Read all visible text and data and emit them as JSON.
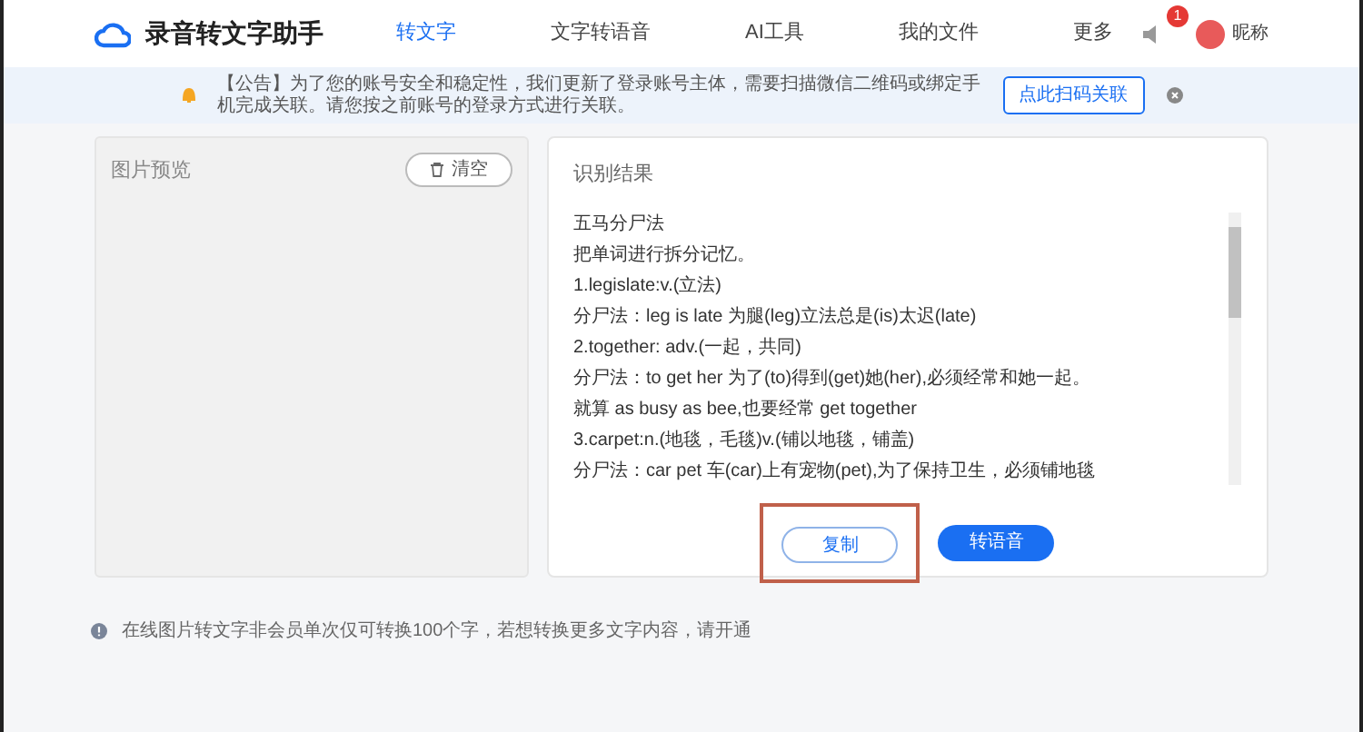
{
  "header": {
    "app_name": "录音转文字助手",
    "nav": [
      {
        "label": "转文字",
        "selected": true
      },
      {
        "label": "文字转语音",
        "selected": false
      },
      {
        "label": "AI工具",
        "selected": false
      },
      {
        "label": "我的文件",
        "selected": false
      },
      {
        "label": "更多",
        "selected": false
      }
    ],
    "notification_count": "1",
    "user_name": "昵称"
  },
  "notice": {
    "text": "【公告】为了您的账号安全和稳定性，我们更新了登录账号主体，需要扫描微信二维码或绑定手机完成关联。请您按之前账号的登录方式进行关联。",
    "button": "点此扫码关联"
  },
  "image_preview": {
    "title": "图片预览",
    "clear_button": "清空"
  },
  "result": {
    "title": "识别结果",
    "lines": [
      "五马分尸法",
      "把单词进行拆分记忆。",
      "1.legislate:v.(立法)",
      "分尸法：leg is late 为腿(leg)立法总是(is)太迟(late)",
      "2.together: adv.(一起，共同)",
      "分尸法：to get her 为了(to)得到(get)她(her),必须经常和她一起。",
      "就算 as busy as bee,也要经常 get together",
      "3.carpet:n.(地毯，毛毯)v.(铺以地毯，铺盖)",
      "分尸法：car pet 车(car)上有宠物(pet),为了保持卫生，必须铺地毯"
    ],
    "copy_button": "复制",
    "speech_button": "转语音"
  },
  "footer_note": "在线图片转文字非会员单次仅可转换100个字，若想转换更多文字内容，请开通"
}
